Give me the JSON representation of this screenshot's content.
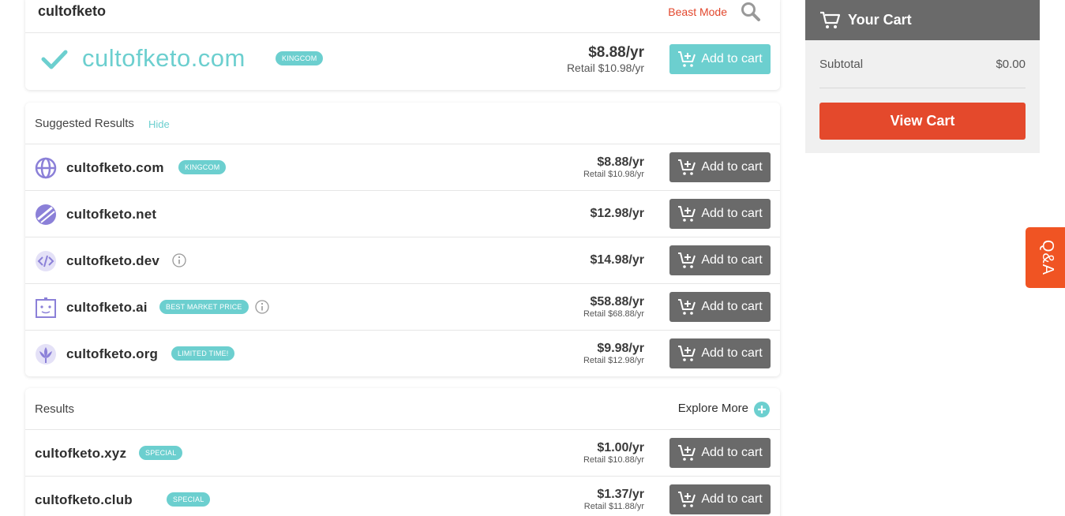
{
  "search": {
    "query": "cultofketo",
    "beast_mode_label": "Beast Mode"
  },
  "exact_match": {
    "domain": "cultofketo.com",
    "badge": "KINGCOM",
    "price": "$8.88/yr",
    "retail": "Retail $10.98/yr",
    "button_label": "Add to cart"
  },
  "suggested": {
    "title": "Suggested Results",
    "hide_label": "Hide",
    "rows": [
      {
        "domain": "cultofketo.com",
        "badge": "KINGCOM",
        "price": "$8.88/yr",
        "retail": "Retail $10.98/yr",
        "button_label": "Add to cart",
        "icon": "globe-icon"
      },
      {
        "domain": "cultofketo.net",
        "badge": "",
        "price": "$12.98/yr",
        "retail": "",
        "button_label": "Add to cart",
        "icon": "net-icon"
      },
      {
        "domain": "cultofketo.dev",
        "badge": "",
        "price": "$14.98/yr",
        "retail": "",
        "button_label": "Add to cart",
        "icon": "code-icon"
      },
      {
        "domain": "cultofketo.ai",
        "badge": "BEST MARKET PRICE",
        "price": "$58.88/yr",
        "retail": "Retail $68.88/yr",
        "button_label": "Add to cart",
        "icon": "robot-icon"
      },
      {
        "domain": "cultofketo.org",
        "badge": "LIMITED TIME!",
        "price": "$9.98/yr",
        "retail": "Retail $12.98/yr",
        "button_label": "Add to cart",
        "icon": "lotus-icon"
      }
    ]
  },
  "results": {
    "title": "Results",
    "explore_label": "Explore More",
    "rows": [
      {
        "domain": "cultofketo.xyz",
        "badge": "SPECIAL",
        "price": "$1.00/yr",
        "retail": "Retail $10.88/yr",
        "button_label": "Add to cart"
      },
      {
        "domain": "cultofketo.club",
        "badge": "SPECIAL",
        "price": "$1.37/yr",
        "retail": "Retail $11.88/yr",
        "button_label": "Add to cart"
      }
    ]
  },
  "cart": {
    "title": "Your Cart",
    "subtotal_label": "Subtotal",
    "subtotal_value": "$0.00",
    "view_cart_label": "View Cart"
  },
  "qa_tab": {
    "label": "Q&A"
  },
  "colors": {
    "accent_teal": "#6ccfcf",
    "brand_orange": "#e4492c",
    "button_gray": "#6a6a6a",
    "icon_purple": "#8b80d8"
  }
}
